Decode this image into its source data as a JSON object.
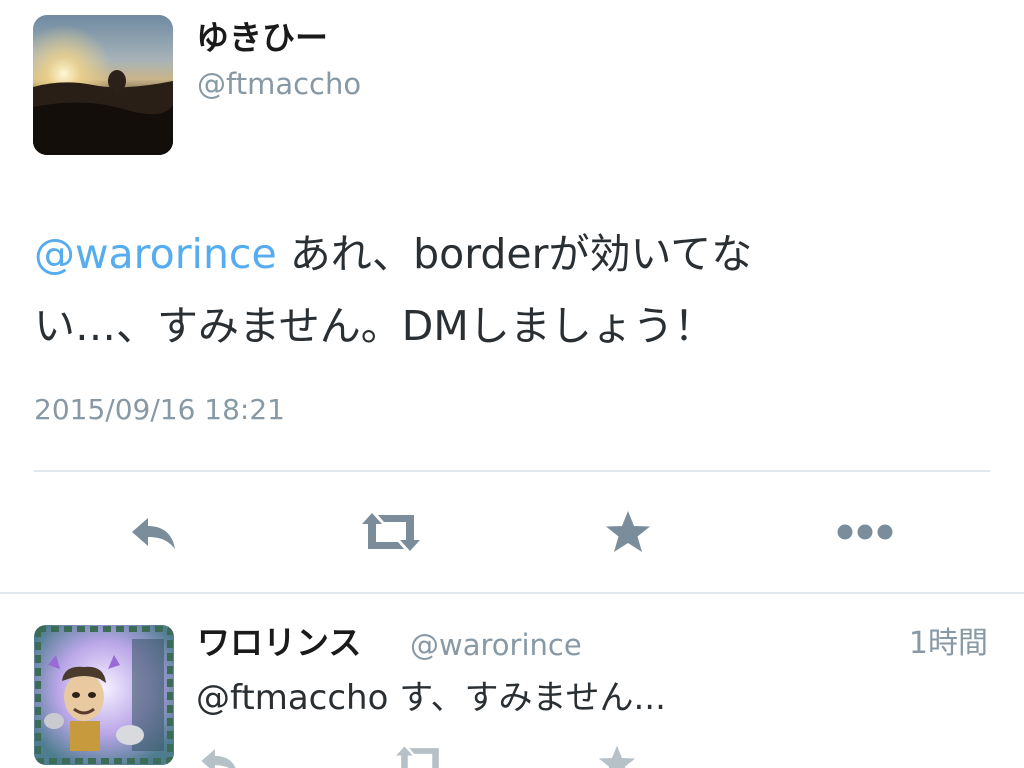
{
  "tweet": {
    "author_name": "ゆきひー",
    "author_handle": "@ftmaccho",
    "mention": "@warorince",
    "text_line1": " あれ、borderが効いてな",
    "text_line2": "い…、すみません。DMしましょう！",
    "timestamp": "2015/09/16 18:21",
    "actions": [
      {
        "label": "reply",
        "icon": "reply-icon"
      },
      {
        "label": "retweet",
        "icon": "retweet-icon"
      },
      {
        "label": "favorite",
        "icon": "star-icon"
      },
      {
        "label": "more",
        "icon": "more-icon"
      }
    ]
  },
  "reply": {
    "author_name": "ワロリンス",
    "author_handle": "@warorince",
    "time": "1時間",
    "text": "@ftmaccho す、すみません..."
  },
  "colors": {
    "text": "#292f33",
    "secondary": "#8899a6",
    "mention": "#55acee",
    "icon": "#7b8d9b",
    "divider": "#e1e8ed"
  }
}
